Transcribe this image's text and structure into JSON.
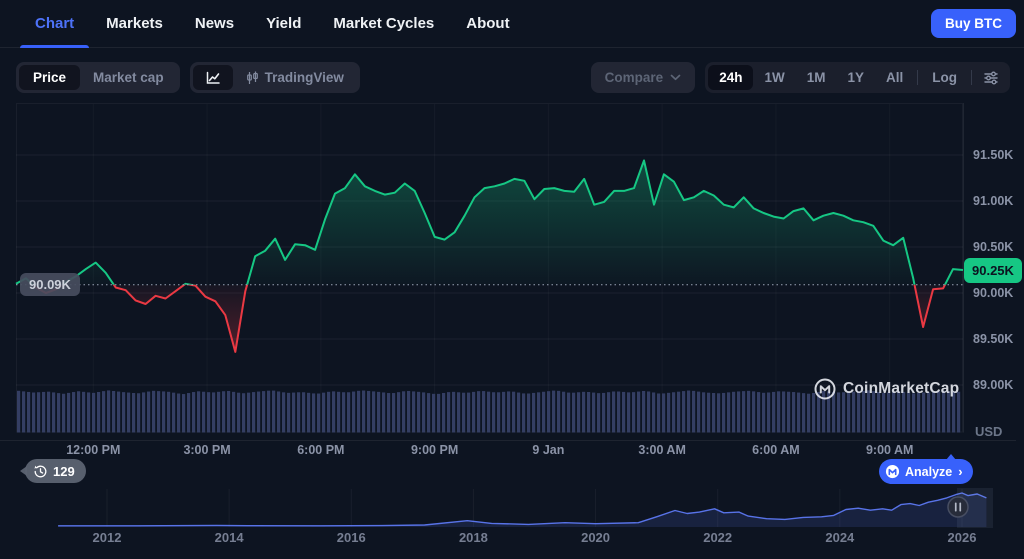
{
  "nav": {
    "items": [
      {
        "label": "Chart",
        "active": true
      },
      {
        "label": "Markets",
        "active": false
      },
      {
        "label": "News",
        "active": false
      },
      {
        "label": "Yield",
        "active": false
      },
      {
        "label": "Market Cycles",
        "active": false
      },
      {
        "label": "About",
        "active": false
      }
    ],
    "buy_button_label": "Buy BTC"
  },
  "toolbar": {
    "price_label": "Price",
    "market_cap_label": "Market cap",
    "tradingview_label": "TradingView",
    "compare_label": "Compare",
    "range_buttons": [
      "24h",
      "1W",
      "1M",
      "1Y",
      "All"
    ],
    "active_range": "24h",
    "log_label": "Log"
  },
  "price_axis": {
    "unit": "USD",
    "ticks": [
      "91.50K",
      "91.00K",
      "90.50K",
      "90.00K",
      "89.50K",
      "89.00K"
    ],
    "tick_values_k": [
      91.5,
      91.0,
      90.5,
      90.0,
      89.5,
      89.0
    ]
  },
  "time_axis": {
    "ticks": [
      "12:00 PM",
      "3:00 PM",
      "6:00 PM",
      "9:00 PM",
      "9 Jan",
      "3:00 AM",
      "6:00 AM",
      "9:00 AM"
    ]
  },
  "history_axis": {
    "ticks": [
      "2012",
      "2014",
      "2016",
      "2018",
      "2020",
      "2022",
      "2024",
      "2026"
    ]
  },
  "badges": {
    "baseline_price": "90.09K",
    "last_price": "90.25K",
    "history_count": "129",
    "analyze_label": "Analyze"
  },
  "watermark": {
    "label": "CoinMarketCap"
  },
  "colors": {
    "background": "#0d1421",
    "accent_blue": "#3861fb",
    "green": "#16c784",
    "red": "#ea3943",
    "gray_text": "#8b93a7",
    "volume_bar": "#343e63",
    "history_line": "#5873e8"
  },
  "chart_data": [
    {
      "type": "line",
      "title": "BTC price, 24h window",
      "ylabel": "USD",
      "y_ticks_k": [
        91.5,
        91.0,
        90.5,
        90.0,
        89.5,
        89.0
      ],
      "x_tick_labels": [
        "12:00 PM",
        "3:00 PM",
        "6:00 PM",
        "9:00 PM",
        "9 Jan",
        "3:00 AM",
        "6:00 AM",
        "9:00 AM"
      ],
      "baseline_k": 90.09,
      "last_k": 90.25,
      "values_k": [
        90.1,
        90.16,
        90.06,
        90.0,
        90.04,
        90.12,
        90.18,
        90.26,
        90.33,
        90.22,
        90.06,
        90.03,
        89.92,
        89.88,
        89.97,
        89.94,
        90.02,
        90.1,
        90.08,
        89.96,
        89.91,
        89.76,
        89.36,
        90.02,
        90.4,
        90.46,
        90.59,
        90.36,
        90.53,
        90.52,
        90.47,
        90.8,
        91.08,
        91.14,
        91.29,
        91.16,
        91.11,
        91.07,
        91.09,
        91.19,
        91.11,
        90.87,
        90.61,
        90.58,
        90.66,
        90.84,
        91.04,
        91.14,
        91.16,
        91.19,
        91.24,
        91.22,
        91.02,
        91.13,
        91.14,
        91.11,
        91.1,
        91.24,
        90.96,
        90.99,
        91.11,
        91.11,
        91.14,
        91.44,
        90.96,
        91.29,
        91.21,
        91.01,
        91.04,
        91.11,
        91.06,
        90.96,
        90.93,
        91.04,
        90.92,
        90.87,
        90.83,
        90.81,
        90.89,
        90.92,
        90.79,
        90.84,
        90.87,
        90.84,
        90.79,
        90.77,
        90.73,
        90.57,
        90.52,
        90.6,
        90.16,
        89.63,
        90.04,
        90.05,
        90.26,
        90.25
      ],
      "volume_profile_normalized": [
        0.97,
        0.93,
        0.95,
        0.9,
        0.96,
        0.92,
        0.98,
        0.94,
        0.91,
        0.97,
        0.95,
        0.89,
        0.96,
        0.93,
        0.97,
        0.91,
        0.95,
        0.98,
        0.92,
        0.94,
        0.9,
        0.96,
        0.93,
        0.98,
        0.95,
        0.91,
        0.97,
        0.94,
        0.89,
        0.95,
        0.92,
        0.97,
        0.93,
        0.96,
        0.9,
        0.94,
        0.98,
        0.92,
        0.95,
        0.91,
        0.96,
        0.93,
        0.97,
        0.9,
        0.94,
        0.98,
        0.93,
        0.91,
        0.95,
        0.97,
        0.92,
        0.96,
        0.94,
        0.9,
        0.97,
        0.93,
        0.95,
        0.98,
        0.92,
        0.96,
        0.91,
        0.94,
        0.97,
        0.95
      ]
    },
    {
      "type": "area",
      "title": "BTC price history (range selector)",
      "x_tick_labels": [
        "2012",
        "2014",
        "2016",
        "2018",
        "2020",
        "2022",
        "2024",
        "2026"
      ],
      "points_year_value_normalized": [
        [
          2011.2,
          0.005
        ],
        [
          2012.5,
          0.005
        ],
        [
          2013.8,
          0.018
        ],
        [
          2014.3,
          0.008
        ],
        [
          2015.5,
          0.006
        ],
        [
          2016.5,
          0.012
        ],
        [
          2017.2,
          0.03
        ],
        [
          2017.9,
          0.16
        ],
        [
          2018.3,
          0.08
        ],
        [
          2018.9,
          0.05
        ],
        [
          2019.5,
          0.1
        ],
        [
          2020.0,
          0.07
        ],
        [
          2020.7,
          0.1
        ],
        [
          2021.0,
          0.28
        ],
        [
          2021.3,
          0.47
        ],
        [
          2021.5,
          0.38
        ],
        [
          2021.7,
          0.42
        ],
        [
          2021.95,
          0.52
        ],
        [
          2022.1,
          0.4
        ],
        [
          2022.35,
          0.42
        ],
        [
          2022.5,
          0.3
        ],
        [
          2022.8,
          0.22
        ],
        [
          2023.1,
          0.2
        ],
        [
          2023.4,
          0.26
        ],
        [
          2023.7,
          0.28
        ],
        [
          2023.9,
          0.32
        ],
        [
          2024.1,
          0.5
        ],
        [
          2024.3,
          0.54
        ],
        [
          2024.5,
          0.48
        ],
        [
          2024.7,
          0.52
        ],
        [
          2024.85,
          0.48
        ],
        [
          2025.0,
          0.65
        ],
        [
          2025.15,
          0.68
        ],
        [
          2025.3,
          0.62
        ],
        [
          2025.45,
          0.72
        ],
        [
          2025.6,
          0.78
        ],
        [
          2025.75,
          0.85
        ],
        [
          2025.9,
          0.95
        ],
        [
          2026.0,
          1.0
        ],
        [
          2026.1,
          0.92
        ],
        [
          2026.25,
          0.97
        ],
        [
          2026.4,
          0.85
        ]
      ]
    }
  ]
}
